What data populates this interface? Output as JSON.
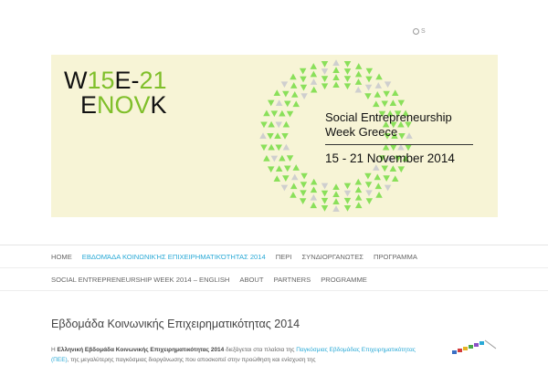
{
  "search": {
    "label": "S"
  },
  "banner": {
    "logo_line1_a": "W",
    "logo_line1_b": "15",
    "logo_line1_c": "E-",
    "logo_line1_d": "21",
    "logo_line2_a": "E",
    "logo_line2_b": "NOV",
    "logo_line2_c": "K",
    "heading_line1": "Social Entrepreneurship",
    "heading_line2": "Week Greece",
    "dates": "15 - 21 November 2014",
    "colors": {
      "background": "#f7f4d6",
      "accent": "#7fbf2a",
      "ring_green": "#8ae05a",
      "ring_gray": "#cfcfcf"
    }
  },
  "nav_primary": {
    "items": [
      {
        "label": "HOME"
      },
      {
        "label": "ΕΒΔΟΜΆΔΑ ΚΟΙΝΩΝΙΚΉΣ ΕΠΙΧΕΙΡΗΜΑΤΙΚΌΤΗΤΑΣ 2014",
        "active": true
      },
      {
        "label": "ΠΕΡΙ"
      },
      {
        "label": "ΣΥΝΔΙΟΡΓΑΝΩΤΕΣ"
      },
      {
        "label": "ΠΡΟΓΡΑΜΜΑ"
      }
    ]
  },
  "nav_secondary": {
    "items": [
      {
        "label": "SOCIAL ENTREPRENEURSHIP WEEK 2014 – ENGLISH"
      },
      {
        "label": "ABOUT"
      },
      {
        "label": "PARTNERS"
      },
      {
        "label": "PROGRAMME"
      }
    ]
  },
  "main": {
    "title": "Εβδομάδα Κοινωνικής Επιχειρηματικότητας 2014",
    "para_1": "Η",
    "para_bold": "Ελληνική Εβδομάδα Κοινωνικής Επιχειρηματικότητας 2014",
    "para_2": "διεξάγεται στα πλαίσια της",
    "para_link": "Παγκόσμιας Εβδομάδας Επιχειρηματικότητας (ΠΕΕ)",
    "para_3": ", της μεγαλύτερης παγκόσμιας διοργάνωσης που αποσκοπεί στην προώθηση και ενίσχυση της"
  },
  "accent_color": "#29a9d6"
}
